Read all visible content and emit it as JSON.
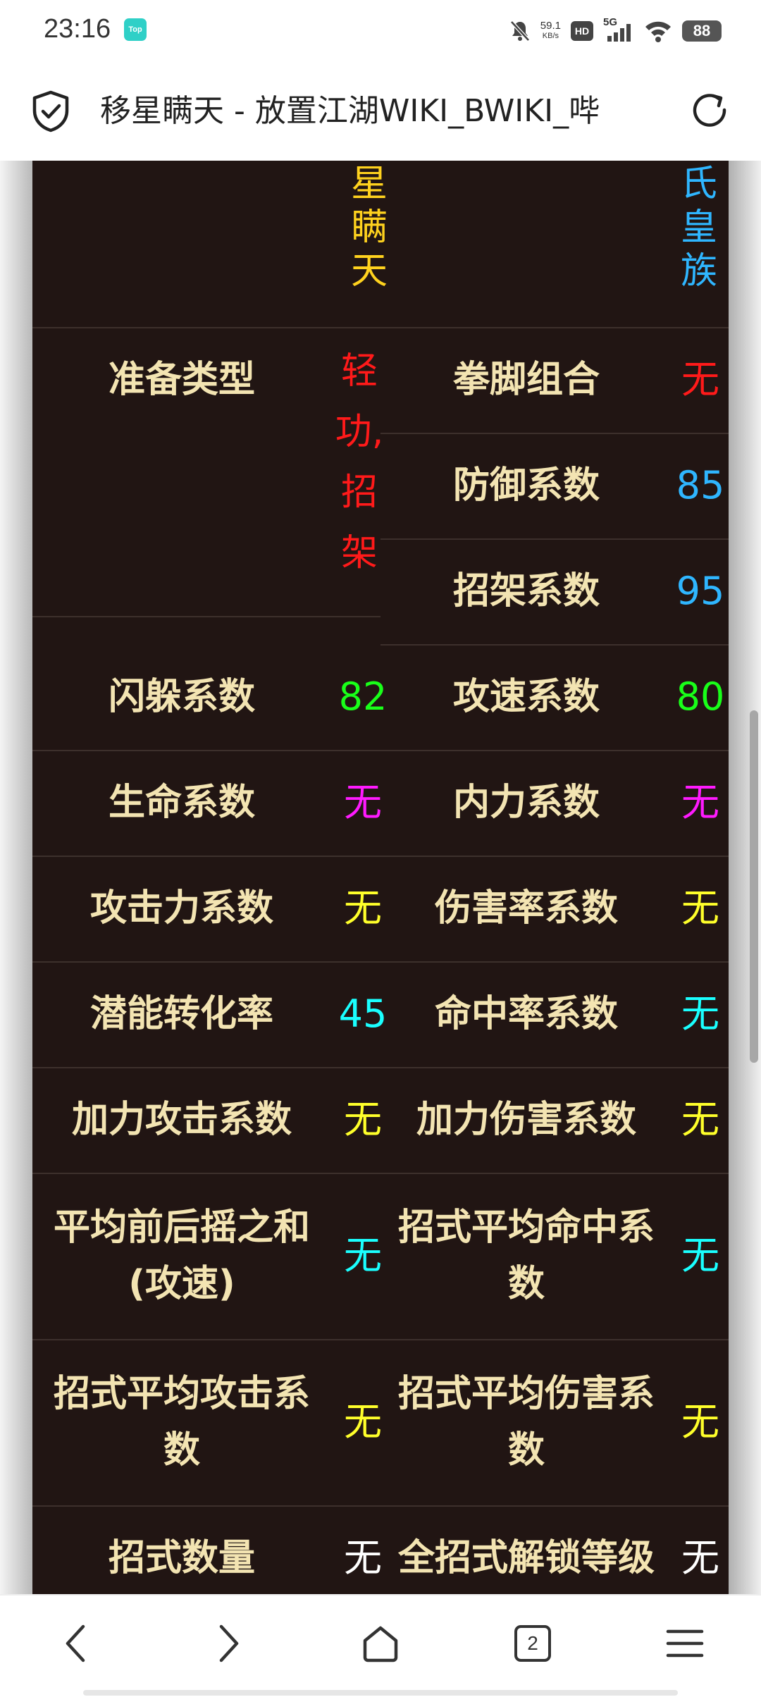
{
  "status_bar": {
    "time": "23:16",
    "app_badge": "Top",
    "net_speed": "59.1",
    "net_unit": "KB/s",
    "hd": "HD",
    "signal": "5G",
    "battery": "88"
  },
  "browser": {
    "title": "移星瞒天 - 放置江湖WIKI_BWIKI_哔",
    "tab_count": "2",
    "icons": [
      "shield-check-icon",
      "reload-icon",
      "back-arrow-icon",
      "forward-arrow-icon",
      "home-icon",
      "tabs-icon",
      "menu-icon"
    ]
  },
  "table": {
    "name_col": {
      "chars": [
        "星",
        "瞒",
        "天"
      ],
      "color": "#ffd21e"
    },
    "faction_col": {
      "chars": [
        "氏",
        "皇",
        "族"
      ],
      "color": "#2fb6ff"
    },
    "prep_type": {
      "label": "准备类型",
      "chars": [
        "轻",
        "功,",
        "招",
        "架"
      ],
      "color": "#ff1a1a"
    },
    "fist_combo": {
      "label": "拳脚组合",
      "value": "无",
      "color": "#ff1a1a"
    },
    "defense": {
      "label": "防御系数",
      "value": "85",
      "color": "#2fb6ff"
    },
    "parry": {
      "label": "招架系数",
      "value": "95",
      "color": "#2fb6ff"
    },
    "dodge": {
      "label": "闪躲系数",
      "value": "82",
      "color": "#19ff19"
    },
    "atk_speed": {
      "label": "攻速系数",
      "value": "80",
      "color": "#19ff19"
    },
    "life": {
      "label": "生命系数",
      "value": "无",
      "color": "#ff1aff"
    },
    "inner_force": {
      "label": "内力系数",
      "value": "无",
      "color": "#ff1aff"
    },
    "attack_power": {
      "label": "攻击力系数",
      "value": "无",
      "color": "#ffff2a"
    },
    "damage_rate": {
      "label": "伤害率系数",
      "value": "无",
      "color": "#ffff2a"
    },
    "potential": {
      "label": "潜能转化率",
      "value": "45",
      "color": "#1affff"
    },
    "hit_rate": {
      "label": "命中率系数",
      "value": "无",
      "color": "#1affff"
    },
    "force_attack": {
      "label": "加力攻击系数",
      "value": "无",
      "color": "#ffff2a"
    },
    "force_damage": {
      "label": "加力伤害系数",
      "value": "无",
      "color": "#ffff2a"
    },
    "swing_sum": {
      "label_line1": "平均前后摇之和",
      "label_line2": "(攻速)",
      "value": "无",
      "color": "#1affff"
    },
    "avg_hit": {
      "label_line1": "招式平均命中系",
      "label_line2": "数",
      "value": "无",
      "color": "#1affff"
    },
    "avg_attack": {
      "label_line1": "招式平均攻击系",
      "label_line2": "数",
      "value": "无",
      "color": "#ffff2a"
    },
    "avg_damage": {
      "label_line1": "招式平均伤害系",
      "label_line2": "数",
      "value": "无",
      "color": "#ffff2a"
    },
    "move_count": {
      "label": "招式数量",
      "value": "无",
      "color": "#ffffff"
    },
    "unlock_level": {
      "label": "全招式解锁等级",
      "value": "无",
      "color": "#ffffff"
    }
  }
}
